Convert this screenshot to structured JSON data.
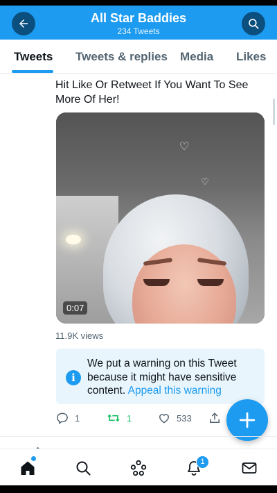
{
  "header": {
    "title": "All Star Baddies",
    "subtitle": "234 Tweets",
    "back_icon": "arrow-left-icon",
    "search_icon": "search-icon"
  },
  "tabs": [
    {
      "label": "Tweets",
      "active": true
    },
    {
      "label": "Tweets & replies",
      "active": false
    },
    {
      "label": "Media",
      "active": false
    },
    {
      "label": "Likes",
      "active": false
    }
  ],
  "tweet": {
    "text": "Hit Like Or Retweet If You Want To See More Of Her!",
    "video_duration": "0:07",
    "views": "11.9K views",
    "warning_text": "We put a warning on this Tweet because it might have sensitive content.",
    "warning_link": "Appeal this warning",
    "replies": "1",
    "retweets": "1",
    "likes": "533"
  },
  "bottom_nav": {
    "items": [
      "home-icon",
      "search-icon",
      "spaces-icon",
      "notifications-icon",
      "messages-icon"
    ],
    "notification_count": "1"
  },
  "colors": {
    "accent": "#1d9bf0",
    "header_button": "#0b4f7f",
    "retweet_green": "#17bf63",
    "warning_bg": "#e8f5fd"
  }
}
